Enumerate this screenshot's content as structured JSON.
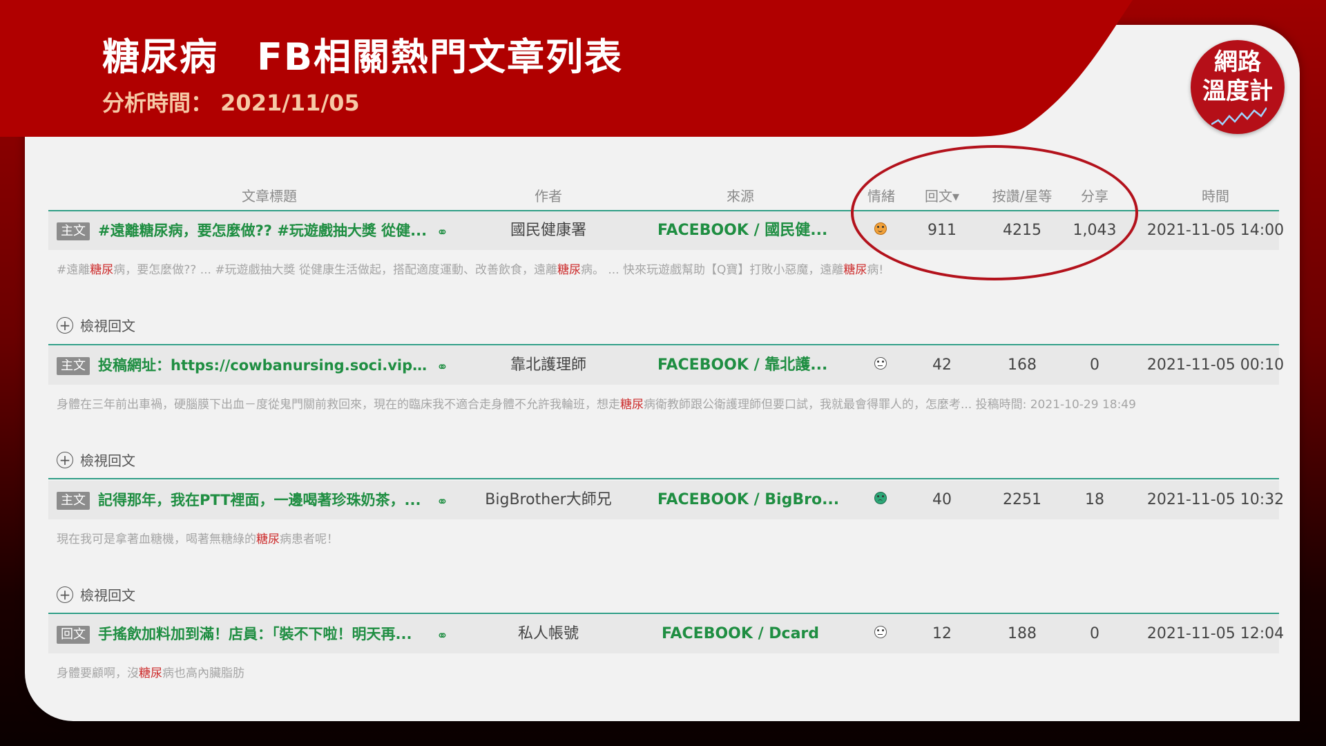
{
  "header": {
    "title": "糖尿病　FB相關熱門文章列表",
    "analysis_label": "分析時間：",
    "analysis_date": "2021/11/05"
  },
  "logo": {
    "line1": "網路",
    "line2": "溫度計"
  },
  "table": {
    "columns": [
      "文章標題",
      "作者",
      "來源",
      "情緒",
      "回文",
      "按讚/星等",
      "分享",
      "時間"
    ],
    "sort_indicator": "▾",
    "view_replies_label": "檢視回文",
    "rows": [
      {
        "type": "主文",
        "title": "#遠離糖尿病，要怎麼做?? #玩遊戲抽大獎 從健...",
        "author": "國民健康署",
        "source": "FACEBOOK / 國民健...",
        "sentiment": "happy-icon",
        "replies": "911",
        "likes": "4215",
        "shares": "1,043",
        "time": "2021-11-05 14:00",
        "excerpt_a": "#遠離",
        "excerpt_b": "糖尿",
        "excerpt_c": "病，要怎麼做?? ... #玩遊戲抽大獎 從健康生活做起，搭配適度運動、改善飲食，遠離",
        "excerpt_d": "糖尿",
        "excerpt_e": "病。 ... 快來玩遊戲幫助【Q寶】打敗小惡魔，遠離",
        "excerpt_f": "糖尿",
        "excerpt_g": "病!"
      },
      {
        "type": "主文",
        "title": "投稿網址：https://cowbanursing.soci.vip/ #...",
        "author": "靠北護理師",
        "source": "FACEBOOK / 靠北護...",
        "sentiment": "neutral-icon",
        "replies": "42",
        "likes": "168",
        "shares": "0",
        "time": "2021-11-05 00:10",
        "excerpt_a": "身體在三年前出車禍，硬腦膜下出血－度從鬼門關前救回來，現在的臨床我不適合走身體不允許我輪班，想走",
        "excerpt_b": "糖尿",
        "excerpt_c": "病衛教師跟公衛護理師但要口試，我就最會得罪人的，怎麼考... 投稿時間: 2021-10-29 18:49"
      },
      {
        "type": "主文",
        "title": "記得那年，我在PTT裡面，一邊喝著珍珠奶茶，...",
        "author": "BigBrother大師兄",
        "source": "FACEBOOK / BigBro...",
        "sentiment": "sad-icon",
        "replies": "40",
        "likes": "2251",
        "shares": "18",
        "time": "2021-11-05 10:32",
        "excerpt_a": "現在我可是拿著血糖機，喝著無糖綠的",
        "excerpt_b": "糖尿",
        "excerpt_c": "病患者呢！"
      },
      {
        "type": "回文",
        "title": "手搖飲加料加到滿！店員：「裝不下啦！明天再...",
        "author": "私人帳號",
        "source": "FACEBOOK / Dcard",
        "sentiment": "neutral-icon",
        "replies": "12",
        "likes": "188",
        "shares": "0",
        "time": "2021-11-05 12:04",
        "excerpt_a": "身體要顧啊，沒",
        "excerpt_b": "糖尿",
        "excerpt_c": "病也高內臟脂肪"
      }
    ]
  },
  "colors": {
    "banner_red": "#b00000",
    "accent_green": "#1f8e42",
    "divider_teal": "#2f9e86",
    "highlight_red": "#cc2b2b"
  }
}
